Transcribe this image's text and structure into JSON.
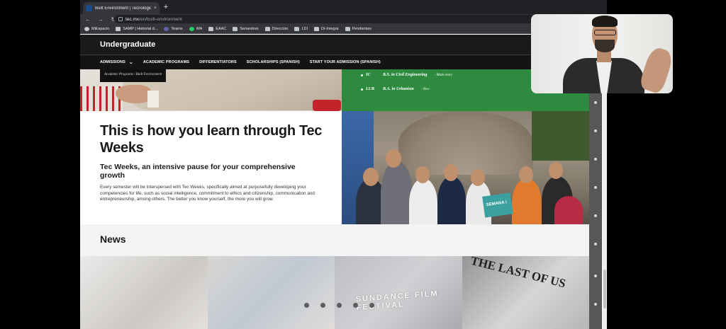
{
  "browser": {
    "tab": {
      "title": "Built Environment | Tecnológico",
      "close_glyph": "×",
      "new_tab_glyph": "+"
    },
    "nav": {
      "back": "←",
      "forward": "→",
      "reload": "↻"
    },
    "address": {
      "domain": "tec.mx",
      "path": "/en/built-environment"
    },
    "bookmarks": [
      {
        "label": "MiEspacio",
        "icon": "round"
      },
      {
        "label": "SAMP | Historial d...",
        "icon": "doc"
      },
      {
        "label": "Teams",
        "icon": "teams"
      },
      {
        "label": "WA",
        "icon": "wa"
      },
      {
        "label": "EAAC",
        "icon": "folder"
      },
      {
        "label": "Semestres",
        "icon": "folder"
      },
      {
        "label": "Dirección",
        "icon": "folder"
      },
      {
        "label": "LDI",
        "icon": "folder"
      },
      {
        "label": "DI-Integra",
        "icon": "folder"
      },
      {
        "label": "Pendientes",
        "icon": "folder"
      }
    ]
  },
  "site": {
    "brand": "Undergraduate",
    "nav": [
      {
        "label": "ADMISSIONS",
        "chevron": "⌄"
      },
      {
        "label": "ACADEMIC PROGRAMS"
      },
      {
        "label": "DIFFERENTIATORS"
      },
      {
        "label": "SCHOLARSHIPS (SPANISH)"
      },
      {
        "label": "START YOUR ADMISSION (SPANISH)"
      }
    ],
    "breadcrumb": "Academic Programs  /  Built Environment",
    "programs": [
      {
        "code": "IC",
        "name": "B.S. in Civil Engineering",
        "note": "- Multi-entry"
      },
      {
        "code": "LUB",
        "name": "B.A. in Urbanism",
        "note": "- New"
      }
    ],
    "headline": "This is how you learn through Tec Weeks",
    "subhead": "Tec Weeks, an intensive pause for your comprehensive growth",
    "body": "Every semester will be interspersed with Tec Weeks, specifically aimed at purposefully developing your competencies for life, such as social intelligence, commitment to ethics and citizenship, communication and entrepreneurship, among others. The better you know yourself, the more you will grow.",
    "photo_sign": "SEMANA i",
    "news_title": "News",
    "news_cards": [
      {
        "caption": ""
      },
      {
        "caption": ""
      },
      {
        "caption": "SUNDANCE FILM FESTIVAL"
      },
      {
        "caption": "THE LAST OF US"
      }
    ],
    "carousel_dots": 5
  },
  "colors": {
    "program_green": "#2d8a3e",
    "site_header": "#1a1a1a",
    "browser_chrome": "#35363a"
  }
}
